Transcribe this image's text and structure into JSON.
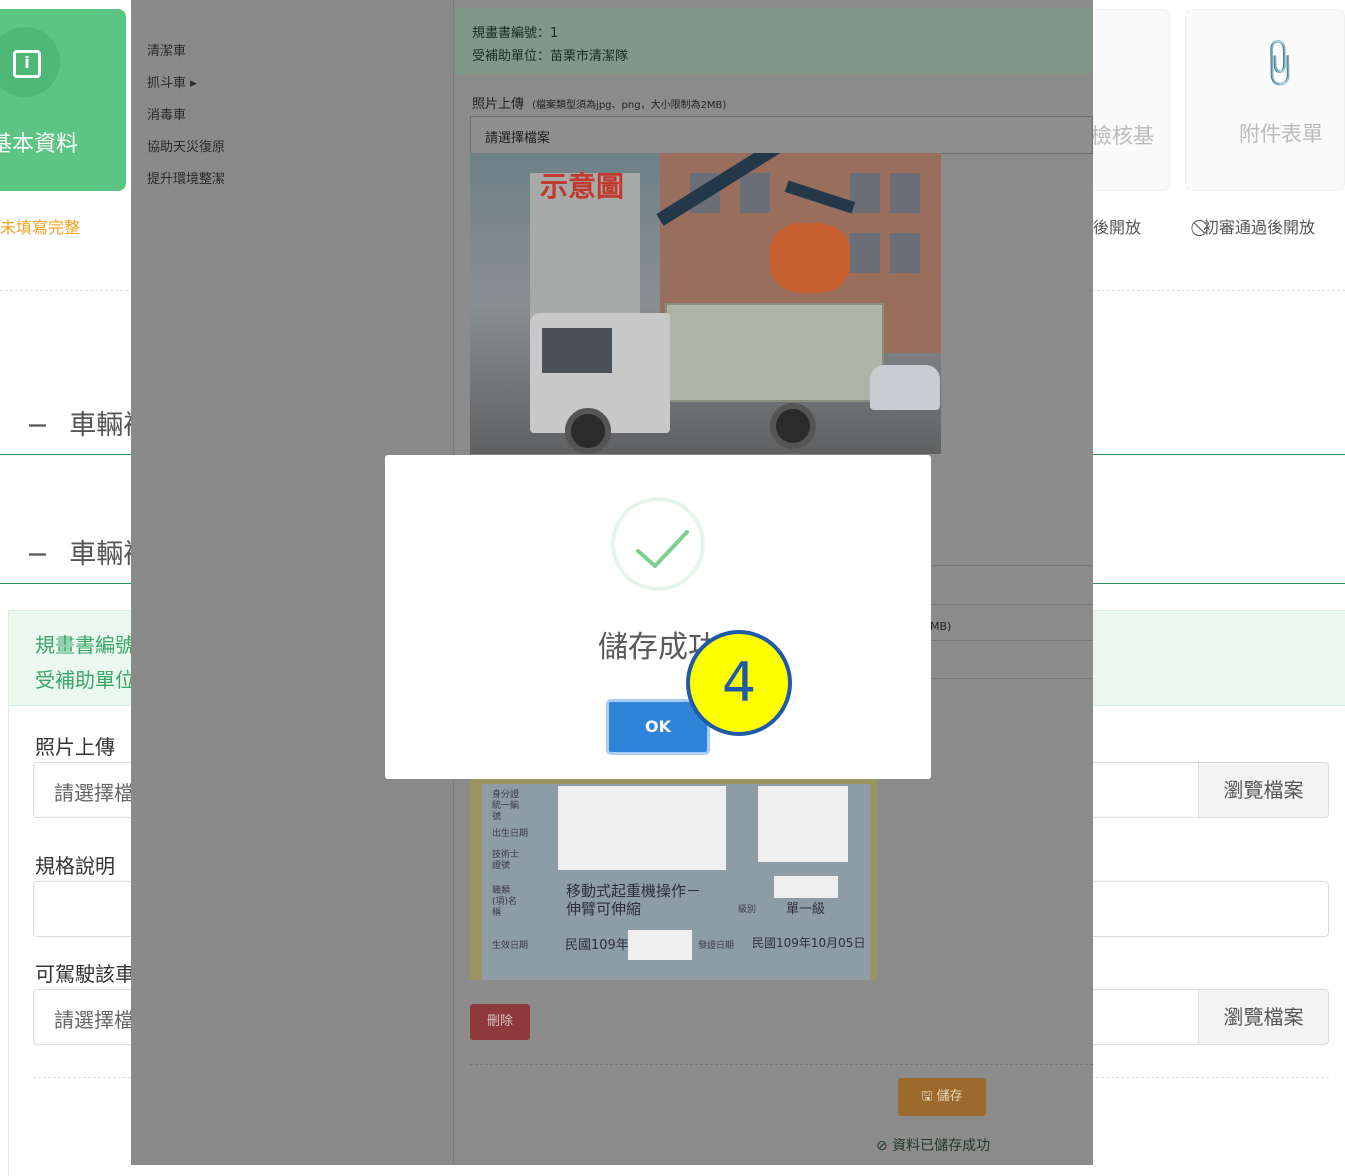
{
  "steps": {
    "basic": {
      "label": "基本資料",
      "status": "未填寫完整",
      "icon": "info-icon"
    },
    "check": {
      "label": "檢核基",
      "status": "後開放"
    },
    "attach": {
      "label": "附件表單",
      "status": "⃠初審通過後開放",
      "icon": "paperclip-icon"
    }
  },
  "sections": [
    {
      "toggle": "−",
      "title": "車輛補"
    },
    {
      "toggle": "−",
      "title": "車輛補"
    }
  ],
  "plan_info": {
    "plan_no_label": "規畫書編號",
    "unit_label": "受補助單位"
  },
  "form": {
    "photo_label": "照片上傳",
    "photo_placeholder": "請選擇檔",
    "spec_label": "規格說明",
    "driver_label": "可駕駛該車",
    "driver_placeholder": "請選擇檔",
    "browse_label": "瀏覽檔案"
  },
  "side_menu": [
    "清潔車",
    "抓斗車 ▸",
    "消毒車",
    "協助天災復原",
    "提升環境整潔"
  ],
  "inner": {
    "plan_no": "規畫書編號：1",
    "unit": "受補助單位：苗栗市清潔隊",
    "photo_label": "照片上傳",
    "photo_hint": "(檔案類型須為jpg、png，大小限制為2MB)",
    "select_file": "請選擇檔案",
    "watermark": "示意圖",
    "hint_tail": "MB)",
    "delete_label": "刪除",
    "save_label": "🖫 儲存",
    "saved_message": "⊘ 資料已儲存成功",
    "license": {
      "row1": "身分證統一編號",
      "row2": "出生日期",
      "row3": "技術士證號",
      "row4": "職類(項)名稱",
      "job": "移動式起重機操作－",
      "job2": "伸臂可伸縮",
      "level_label": "級別",
      "level": "單一級",
      "valid_label": "生效日期",
      "valid": "民國109年",
      "issue_label": "發證日期",
      "issue": "民國109年10月05日"
    }
  },
  "dialog": {
    "title": "儲存成功",
    "ok_label": "OK",
    "icon": "checkmark-icon"
  },
  "step_marker": "4"
}
